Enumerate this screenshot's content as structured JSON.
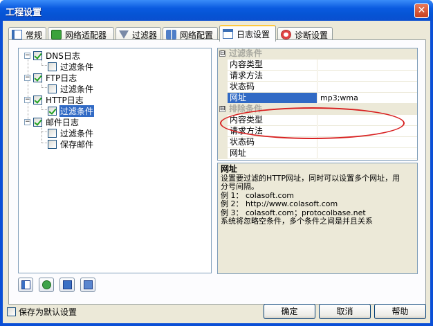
{
  "window": {
    "title": "工程设置",
    "close_glyph": "✕"
  },
  "tabs": [
    {
      "label": "常规",
      "icon": "general-icon"
    },
    {
      "label": "网络适配器",
      "icon": "adapter-icon"
    },
    {
      "label": "过滤器",
      "icon": "filter-icon"
    },
    {
      "label": "网络配置",
      "icon": "network-config-icon"
    },
    {
      "label": "日志设置",
      "icon": "log-settings-icon",
      "active": true
    },
    {
      "label": "诊断设置",
      "icon": "diagnosis-icon"
    }
  ],
  "tree": {
    "expander": "−",
    "nodes": [
      {
        "label": "DNS日志",
        "checked": true
      },
      {
        "label": "过滤条件",
        "checked": false
      },
      {
        "label": "FTP日志",
        "checked": true
      },
      {
        "label": "过滤条件",
        "checked": false
      },
      {
        "label": "HTTP日志",
        "checked": true
      },
      {
        "label": "过滤条件",
        "checked": true,
        "selected": true
      },
      {
        "label": "邮件日志",
        "checked": true
      },
      {
        "label": "过滤条件",
        "checked": false
      },
      {
        "label": "保存邮件",
        "checked": false
      }
    ]
  },
  "properties": {
    "cat_glyph": "⊟",
    "cat1": "过滤条件",
    "rows1": [
      {
        "name": "内容类型",
        "value": ""
      },
      {
        "name": "请求方法",
        "value": ""
      },
      {
        "name": "状态码",
        "value": ""
      },
      {
        "name": "网址",
        "value": "mp3;wma",
        "selected": true
      }
    ],
    "cat2": "排除条件",
    "rows2": [
      {
        "name": "内容类型",
        "value": ""
      },
      {
        "name": "请求方法",
        "value": ""
      },
      {
        "name": "状态码",
        "value": ""
      },
      {
        "name": "网址",
        "value": ""
      }
    ]
  },
  "description": {
    "title": "网址",
    "lines": [
      "设置要过滤的HTTP网址，同时可以设置多个网址，用",
      "分号间隔。",
      "例 1： colasoft.com",
      "例 2： http://www.colasoft.com",
      "例 3： colasoft.com；protocolbase.net",
      "系统将忽略空条件，多个条件之间是并且关系"
    ]
  },
  "footer": {
    "default_checkbox": "保存为默认设置",
    "ok": "确定",
    "cancel": "取消",
    "help": "帮助"
  },
  "colors": {
    "title_bar": "#0a5ae0",
    "selection": "#316ac5",
    "highlight_ellipse": "#d82020",
    "dialog_bg": "#ece9d8"
  }
}
